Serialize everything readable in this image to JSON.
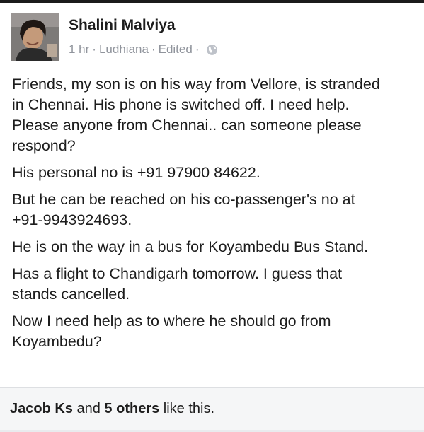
{
  "post": {
    "author": "Shalini Malviya",
    "time": "1 hr",
    "location": "Ludhiana",
    "edited": "Edited",
    "separator": "·",
    "paragraphs": [
      "Friends, my son is on his way from Vellore, is stranded\nin Chennai. His phone is switched off. I need help.\nPlease anyone from Chennai.. can someone please\nrespond?",
      "His personal no is +91 97900 84622.",
      "But he can be reached on his co-passenger's no at\n+91-9943924693.",
      "He is on the way in a bus for Koyambedu Bus Stand.",
      "Has a flight to Chandigarh tomorrow. I guess that\nstands cancelled.",
      "Now I need help as to where he should go from\nKoyambedu?"
    ]
  },
  "likes": {
    "first_name": "Jacob Ks",
    "and": " and ",
    "others": "5 others",
    "suffix": " like this."
  },
  "icons": {
    "privacy": "globe-icon"
  }
}
